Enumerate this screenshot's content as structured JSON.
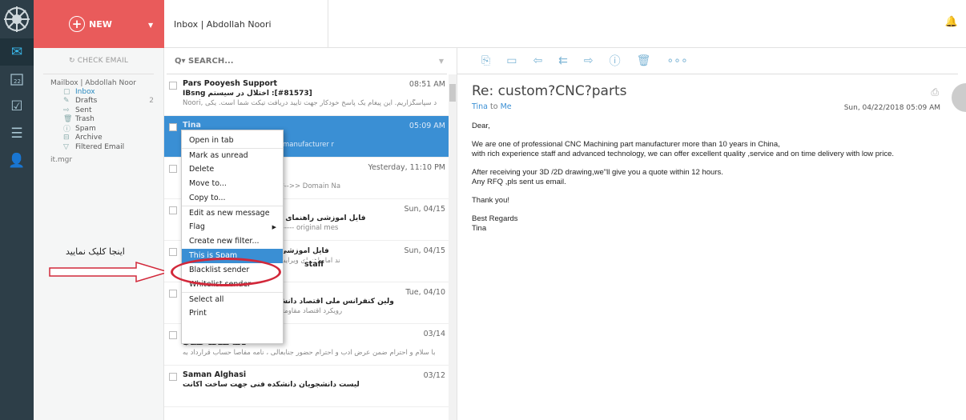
{
  "topbar": {
    "new_label": "NEW",
    "tab_title": "Inbox | Abdollah Noori"
  },
  "folders": {
    "check_email": "CHECK EMAIL",
    "mailbox_title": "Mailbox | Abdollah Noor",
    "items": [
      {
        "label": "Inbox",
        "icon": "inbox-icon",
        "count": ""
      },
      {
        "label": "Drafts",
        "icon": "drafts-icon",
        "count": "2"
      },
      {
        "label": "Sent",
        "icon": "sent-icon",
        "count": ""
      },
      {
        "label": "Trash",
        "icon": "trash-icon",
        "count": ""
      },
      {
        "label": "Spam",
        "icon": "spam-icon",
        "count": ""
      },
      {
        "label": "Archive",
        "icon": "archive-icon",
        "count": ""
      },
      {
        "label": "Filtered Email",
        "icon": "filter-icon",
        "count": ""
      }
    ],
    "extra": "it.mgr"
  },
  "annotation": {
    "text": "اینجا کلیک نمایید"
  },
  "search": {
    "placeholder": "SEARCH..."
  },
  "messages": [
    {
      "from": "Pars Pooyesh Support",
      "date": "08:51 AM",
      "subject": "[#81573]: اختلال در سیستم IBsng",
      "preview": "د سپاسگزاریم. این پیغام یک پاسخ خودکار جهت تایید دریافت تیکت شما است. یکی ,Noori"
    },
    {
      "from": "Tina",
      "date": "05:09 AM",
      "subject": "Re",
      "preview": "De                         ional CNC Machining part manufacturer r"
    },
    {
      "from": "ro",
      "date": "Yesterday, 11:10 PM",
      "subject": "Ax                        2018-04-22",
      "preview": "<<                        Script Version: 1.1.6 *****-->> Domain Na"
    },
    {
      "from": "ی",
      "date": "Sun, 04/15",
      "subject": "[Fv                         [فایل آموزشی راهنمای ویرایش صفحات شخص",
      "preview": "Au                      r: IT.Mgr@razi.ac.ir -------------- original mes"
    },
    {
      "from": "",
      "date": "Sun, 04/15",
      "subject": "[F                         [فایل آموزشی راهنمای ویرایش صفحا",
      "preview": "ند                     اما راهنمای ویرایش صفحات شخصی در پرتال دانشگ"
    },
    {
      "from": "ی",
      "date": "Tue, 04/10",
      "subject": "[Fv                  ولین کنفرانس ملی اقتصاد دانش با رویکرد اقتصاد مقاو",
      "preview": "<h                om/> ۱۳۹۷ رویکرد اقتصاد مقاومتی / ۲۱ اردیبهشت"
    },
    {
      "from": "Mandana Jebeli",
      "date": "03/14",
      "subject": "نامه مفاصا حساب",
      "preview": "با سلام و احترام ضمن عرض ادب و احترام حضور جنابعالی ، نامه مفاصا حساب قرارداد به"
    },
    {
      "from": "Saman Alghasi",
      "date": "03/12",
      "subject": "لیست دانشجویان دانشکده فنی جهت ساخت اکانت",
      "preview": ""
    }
  ],
  "second_from": "staff",
  "context_menu": [
    {
      "label": "Open in tab"
    },
    {
      "label": "Mark as unread"
    },
    {
      "label": "Delete"
    },
    {
      "label": "Move to..."
    },
    {
      "label": "Copy to..."
    },
    {
      "label": "Edit as new message"
    },
    {
      "label": "Flag"
    },
    {
      "label": "Create new filter..."
    },
    {
      "label": "This is Spam"
    },
    {
      "label": "Blacklist sender"
    },
    {
      "label": "Whitelist sender"
    },
    {
      "label": "Select all"
    },
    {
      "label": "Print"
    }
  ],
  "reader": {
    "subject": "Re: custom?CNC?parts",
    "from": "Tina",
    "to_word": "to",
    "to": "Me",
    "date": "Sun, 04/22/2018 05:09 AM",
    "body": [
      "Dear,",
      "We are one of professional CNC Machining part manufacturer more than 10 years in China,\nwith rich experience staff and advanced technology, we can offer excellent quality ,service and on time delivery with low price.",
      "After receiving your 3D /2D drawing,we\"ll give you a quote within 12 hours.\nAny RFQ ,pls sent us email.",
      "Thank you!",
      "Best Regards\nTina"
    ]
  },
  "colors": {
    "accent": "#3a8fd4",
    "new_button": "#e95b5b",
    "sidebar": "#2d3e48",
    "highlight_oval": "#d2283a"
  }
}
